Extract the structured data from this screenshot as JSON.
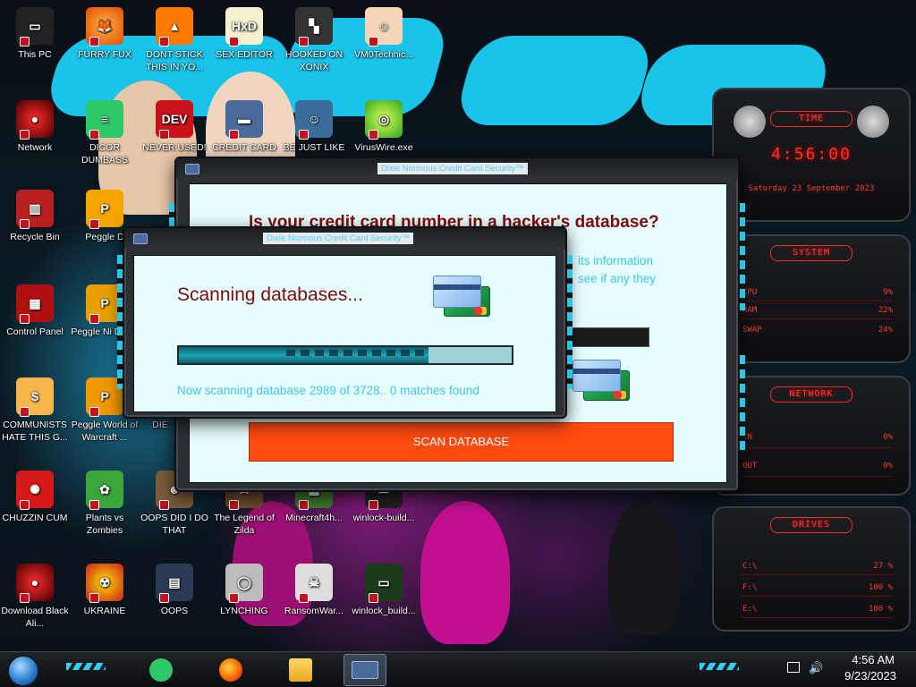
{
  "desktop": {
    "icons": [
      {
        "id": "this-pc",
        "label": "This PC"
      },
      {
        "id": "furry-fux",
        "label": "FURRY FUX"
      },
      {
        "id": "dont-stick",
        "label": "DONT STICK THIS IN YO..."
      },
      {
        "id": "sex-editor",
        "label": "SEX EDITOR"
      },
      {
        "id": "hooked-on-xonix",
        "label": "HOOKED ON XONIX"
      },
      {
        "id": "vm0technic",
        "label": "VM0Technic..."
      },
      {
        "id": "network",
        "label": "Network"
      },
      {
        "id": "dicor-dumbass",
        "label": "DICOR DUMBASS"
      },
      {
        "id": "never-used",
        "label": "NEVER USED!"
      },
      {
        "id": "credit-card",
        "label": "CREDIT CARD"
      },
      {
        "id": "be-just-like",
        "label": "BE JUST LIKE"
      },
      {
        "id": "viruswire",
        "label": "VirusWire.exe"
      },
      {
        "id": "recycle-bin",
        "label": "Recycle Bin"
      },
      {
        "id": "peggle-d",
        "label": "Peggle D"
      },
      {
        "id": "control-panel",
        "label": "Control Panel"
      },
      {
        "id": "peggle-nights",
        "label": "Peggle Ni Delux"
      },
      {
        "id": "communists",
        "label": "COMMUNISTS HATE THIS G..."
      },
      {
        "id": "peggle-world",
        "label": "Peggle World of Warcraft ..."
      },
      {
        "id": "die",
        "label": "DIE"
      },
      {
        "id": "chuzzin",
        "label": "CHUZZIN CUM"
      },
      {
        "id": "pvz",
        "label": "Plants vs Zombies"
      },
      {
        "id": "oops-did",
        "label": "OOPS DID I DO THAT"
      },
      {
        "id": "zilda",
        "label": "The Legend of Zilda"
      },
      {
        "id": "minecraft",
        "label": "Minecraft4h..."
      },
      {
        "id": "winlock1",
        "label": "winlock-build..."
      },
      {
        "id": "download-black",
        "label": "Download Black Ali..."
      },
      {
        "id": "ukraine",
        "label": "UKRAINE"
      },
      {
        "id": "oops",
        "label": "OOPS"
      },
      {
        "id": "lynching",
        "label": "LYNCHING"
      },
      {
        "id": "ransomwar",
        "label": "RansomWar..."
      },
      {
        "id": "winlock2",
        "label": "winlock_build..."
      }
    ]
  },
  "gadget": {
    "time": {
      "title": "TIME",
      "clock": "4:56:00",
      "date": "Saturday 23 September 2023"
    },
    "system": {
      "title": "SYSTEM",
      "rows": [
        {
          "label": "CPU",
          "value": "9%"
        },
        {
          "label": "RAM",
          "value": "22%"
        },
        {
          "label": "SWAP",
          "value": "24%"
        }
      ]
    },
    "network": {
      "title": "NETWORK",
      "rows": [
        {
          "label": "IN",
          "value": "0%"
        },
        {
          "label": "OUT",
          "value": "0%"
        }
      ]
    },
    "drives": {
      "title": "DRIVES",
      "rows": [
        {
          "label": "C:\\",
          "value": "27 %"
        },
        {
          "label": "F:\\",
          "value": "100 %"
        },
        {
          "label": "E:\\",
          "value": "100 %"
        }
      ]
    }
  },
  "back_window": {
    "title": "Dixie Normous Credit Card Security™",
    "heading": "Is your credit card number in a hacker's database?",
    "text_line1": "its information",
    "text_line2": "see if any they",
    "scan_button": "SCAN DATABASE"
  },
  "front_window": {
    "title": "Dixie Normous Credit Card Security™",
    "heading": "Scanning databases...",
    "progress": 0.75,
    "status": "Now scanning database 2989 of 3728.. 0 matches found"
  },
  "taskbar": {
    "apps": [
      {
        "id": "feedly",
        "icon": "green-notes-icon"
      },
      {
        "id": "firefox",
        "icon": "firefox-icon"
      },
      {
        "id": "explorer",
        "icon": "folder-icon"
      },
      {
        "id": "credit-card-app",
        "icon": "credit-card-icon"
      }
    ],
    "clock_time": "4:56 AM",
    "clock_date": "9/23/2023"
  },
  "colors": {
    "accent_cyan": "#3fc6ea",
    "heading_red": "#7d0a0a",
    "button_orange": "#ff4a10",
    "gadget_red": "#ff2a20"
  }
}
